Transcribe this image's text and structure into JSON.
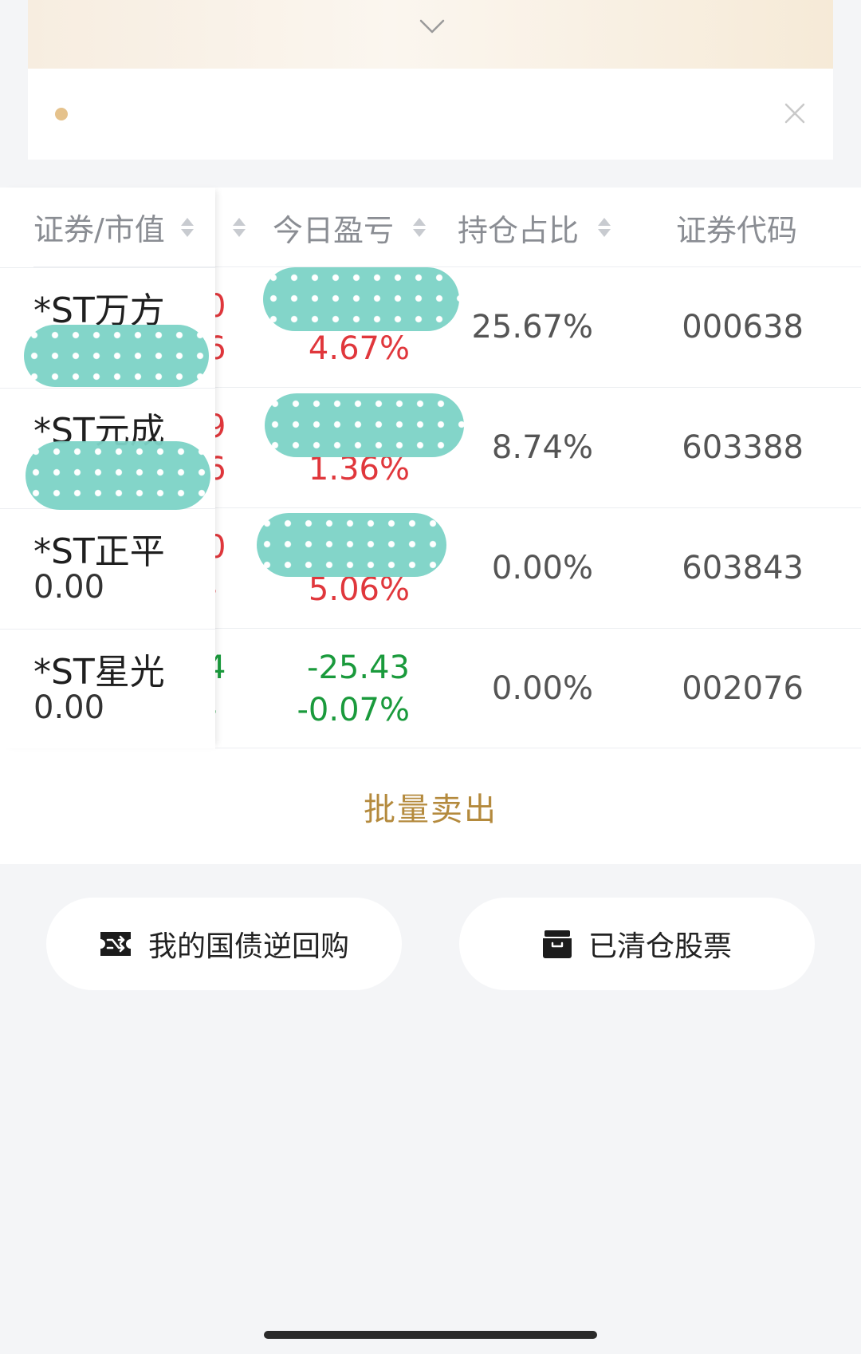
{
  "banner": {
    "chevron_icon": "chevron-down-icon",
    "close_icon": "close-icon",
    "dot_color": "#e5c28c"
  },
  "table": {
    "headers": {
      "security": "证券/市值",
      "today_pnl": "今日盈亏",
      "position_ratio": "持仓占比",
      "code": "证券代码"
    },
    "rows": [
      {
        "name": "*ST万方",
        "market_value": "",
        "frag_top": "0",
        "frag_bottom": "6",
        "pnl": "",
        "pnl_pct": "4.67%",
        "ratio": "25.67%",
        "code": "000638",
        "trend": "red"
      },
      {
        "name": "*ST元成",
        "market_value": "",
        "frag_top": "9",
        "frag_bottom": "6",
        "pnl": "",
        "pnl_pct": "1.36%",
        "ratio": "8.74%",
        "code": "603388",
        "trend": "red"
      },
      {
        "name": "*ST正平",
        "market_value": "0.00",
        "frag_top": "0",
        "frag_bottom": "-",
        "pnl": "",
        "pnl_pct": "5.06%",
        "ratio": "0.00%",
        "code": "603843",
        "trend": "red"
      },
      {
        "name": "*ST星光",
        "market_value": "0.00",
        "frag_top": "4",
        "frag_bottom": "-",
        "pnl": "-25.43",
        "pnl_pct": "-0.07%",
        "ratio": "0.00%",
        "code": "002076",
        "trend": "green"
      }
    ],
    "batch_sell_label": "批量卖出"
  },
  "actions": {
    "repo_label": "我的国债逆回购",
    "repo_icon": "ticket-icon",
    "cleared_label": "已清仓股票",
    "cleared_icon": "archive-box-icon"
  },
  "colors": {
    "up": "#e0373c",
    "down": "#1a9a3c",
    "accent": "#b48a3d"
  }
}
